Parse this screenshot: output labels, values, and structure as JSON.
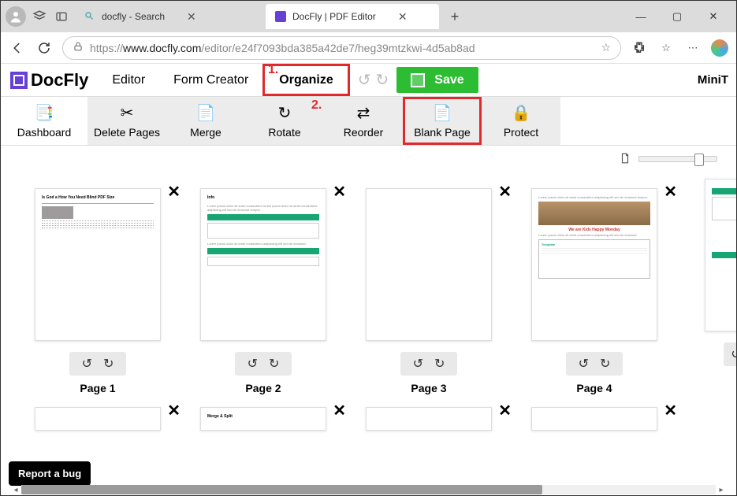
{
  "browser": {
    "tabs": [
      {
        "title": "docfly - Search",
        "active": false
      },
      {
        "title": "DocFly | PDF Editor",
        "active": true
      }
    ],
    "url_prefix": "https://",
    "url_host": "www.docfly.com",
    "url_path": "/editor/e24f7093bda385a42de7/heg39mtzkwi-4d5ab8ad"
  },
  "app": {
    "logo_text": "DocFly",
    "tabs": {
      "editor": "Editor",
      "form": "Form Creator",
      "organize": "Organize"
    },
    "save": "Save",
    "minitool": "MiniT"
  },
  "annots": {
    "one": "1.",
    "two": "2."
  },
  "toolbar": {
    "dashboard": "Dashboard",
    "delete": "Delete Pages",
    "merge": "Merge",
    "rotate": "Rotate",
    "reorder": "Reorder",
    "blank": "Blank Page",
    "protect": "Protect"
  },
  "pages": {
    "row1": [
      {
        "label": "Page 1",
        "heading": "Is God a How You Need Blind PDF Size"
      },
      {
        "label": "Page 2",
        "heading": "Info"
      },
      {
        "label": "Page 3",
        "heading": ""
      },
      {
        "label": "Page 4",
        "heading": "We are Kids Happy Monday"
      }
    ],
    "row2_heading": "Merge & Split"
  },
  "bug": "Report a bug"
}
